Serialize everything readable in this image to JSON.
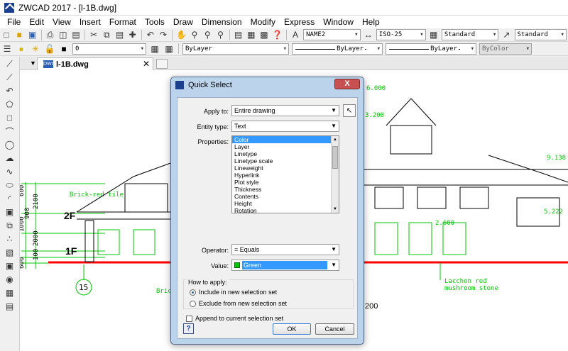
{
  "window": {
    "title": "ZWCAD 2017 - [l-1B.dwg]"
  },
  "menu": [
    "File",
    "Edit",
    "View",
    "Insert",
    "Format",
    "Tools",
    "Draw",
    "Dimension",
    "Modify",
    "Express",
    "Window",
    "Help"
  ],
  "toolbar1": {
    "text_style": "NAME2",
    "dim_style": "ISO-25",
    "table_style": "Standard",
    "multileader_style": "Standard"
  },
  "toolbar2": {
    "layer": "0",
    "color": "ByLayer",
    "linetype": "ByLayer",
    "lineweight": "ByLayer",
    "plotstyle": "ByColor"
  },
  "doc_tab": {
    "label": "l-1B.dwg"
  },
  "drawing": {
    "elev_labels": [
      "6.000",
      "3.200",
      "9.138",
      "5.222",
      "2.600"
    ],
    "floors": [
      "2F",
      "1F"
    ],
    "dims_vertical": [
      "600",
      "2100",
      "1000",
      "900",
      "2000",
      "100",
      "600"
    ],
    "grid_bubble": "15",
    "notes": [
      "Brick-red tile",
      "Brick",
      "Lacchon red",
      "mushroom stone"
    ],
    "dim_bottom": "200"
  },
  "dialog": {
    "title": "Quick Select",
    "close": "X",
    "apply_to_label": "Apply to:",
    "apply_to_value": "Entire drawing",
    "entity_type_label": "Entity type:",
    "entity_type_value": "Text",
    "properties_label": "Properties:",
    "properties": [
      "Color",
      "Layer",
      "Linetype",
      "Linetype scale",
      "Lineweight",
      "Hyperlink",
      "Plot style",
      "Thickness",
      "Contents",
      "Height",
      "Rotation"
    ],
    "selected_property": "Color",
    "operator_label": "Operator:",
    "operator_value": "= Equals",
    "value_label": "Value:",
    "value_value": "Green",
    "value_color": "#00c800",
    "how_to_apply": "How to apply:",
    "radio_include": "Include in new selection set",
    "radio_exclude": "Exclude from new selection set",
    "append_label": "Append to current selection set",
    "help": "?",
    "ok": "OK",
    "cancel": "Cancel"
  }
}
